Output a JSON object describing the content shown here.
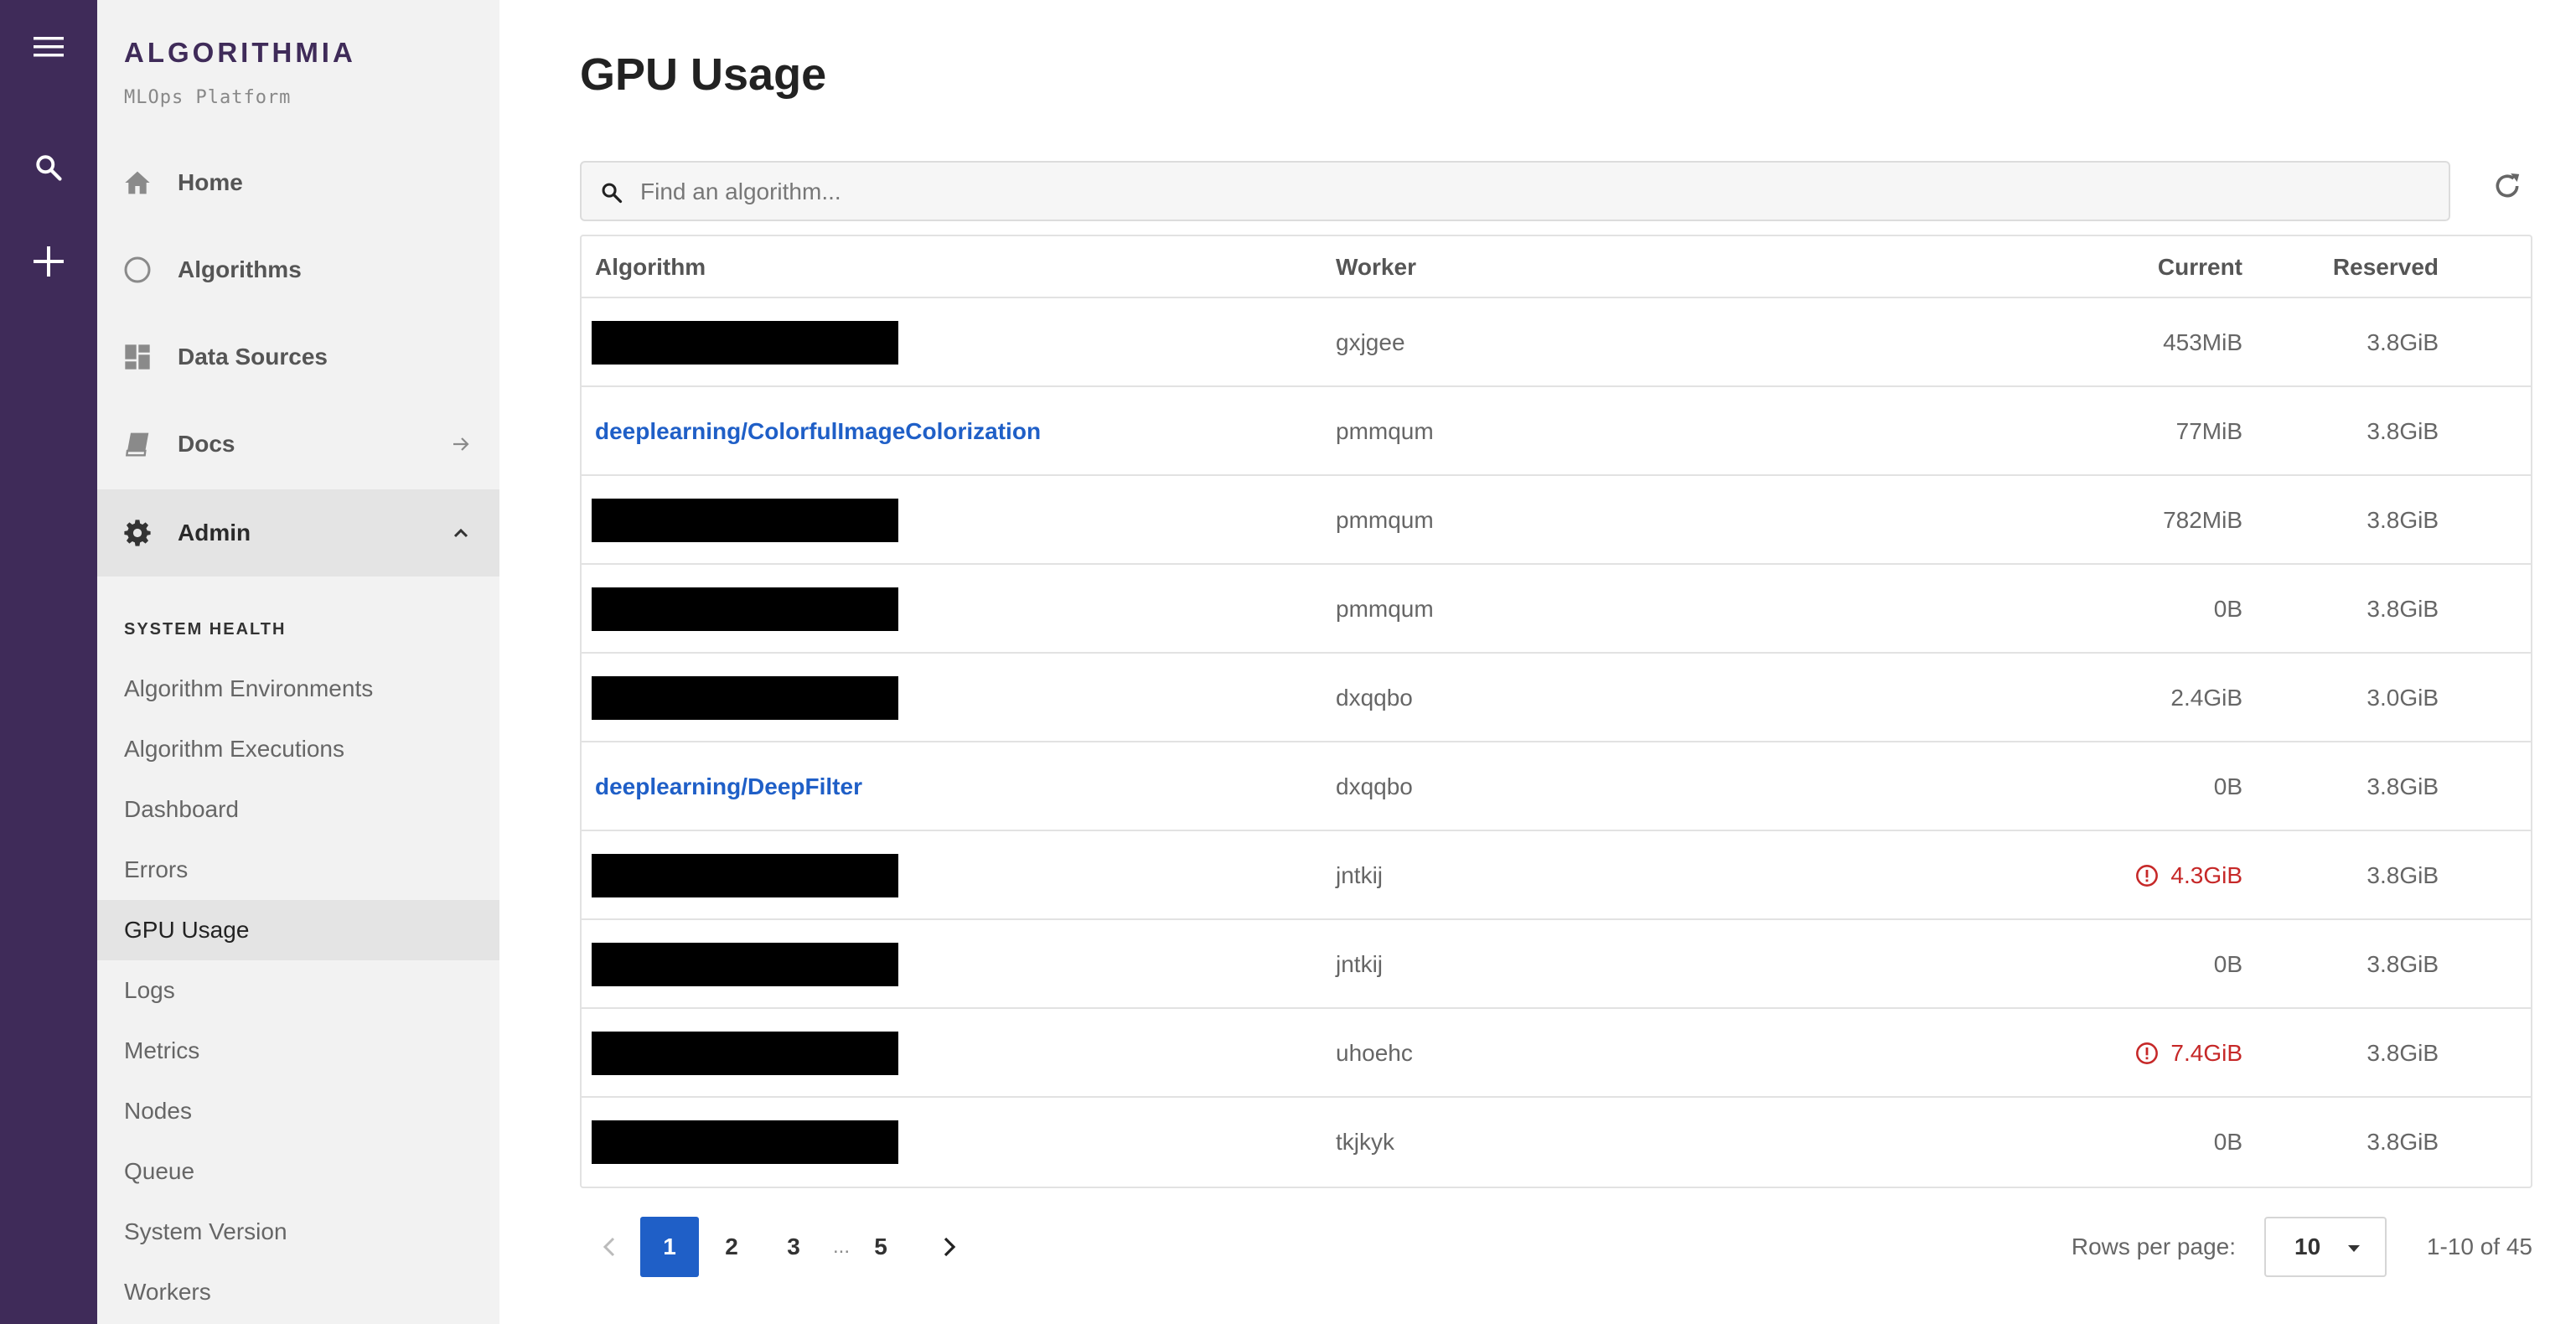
{
  "rail": {
    "icons": [
      "menu-icon",
      "search-icon",
      "plus-icon"
    ]
  },
  "sidebar": {
    "brand": "ALGORITHMIA",
    "tagline": "MLOps Platform",
    "nav": [
      {
        "label": "Home",
        "icon": "home-icon"
      },
      {
        "label": "Algorithms",
        "icon": "circle-icon"
      },
      {
        "label": "Data Sources",
        "icon": "dashboard-icon"
      },
      {
        "label": "Docs",
        "icon": "book-icon"
      },
      {
        "label": "Admin",
        "icon": "gear-icon"
      }
    ],
    "section_heading": "SYSTEM HEALTH",
    "sub_items": [
      {
        "label": "Algorithm Environments"
      },
      {
        "label": "Algorithm Executions"
      },
      {
        "label": "Dashboard"
      },
      {
        "label": "Errors"
      },
      {
        "label": "GPU Usage"
      },
      {
        "label": "Logs"
      },
      {
        "label": "Metrics"
      },
      {
        "label": "Nodes"
      },
      {
        "label": "Queue"
      },
      {
        "label": "System Version"
      },
      {
        "label": "Workers"
      }
    ],
    "active_sub_item": "GPU Usage"
  },
  "main": {
    "title": "GPU Usage",
    "search": {
      "placeholder": "Find an algorithm..."
    },
    "table": {
      "headers": {
        "algorithm": "Algorithm",
        "worker": "Worker",
        "current": "Current",
        "reserved": "Reserved"
      },
      "rows": [
        {
          "algorithm": "",
          "redacted": true,
          "worker": "gxjgee",
          "current": "453MiB",
          "over": false,
          "reserved": "3.8GiB"
        },
        {
          "algorithm": "deeplearning/ColorfulImageColorization",
          "redacted": false,
          "worker": "pmmqum",
          "current": "77MiB",
          "over": false,
          "reserved": "3.8GiB"
        },
        {
          "algorithm": "",
          "redacted": true,
          "worker": "pmmqum",
          "current": "782MiB",
          "over": false,
          "reserved": "3.8GiB"
        },
        {
          "algorithm": "",
          "redacted": true,
          "worker": "pmmqum",
          "current": "0B",
          "over": false,
          "reserved": "3.8GiB"
        },
        {
          "algorithm": "",
          "redacted": true,
          "worker": "dxqqbo",
          "current": "2.4GiB",
          "over": false,
          "reserved": "3.0GiB"
        },
        {
          "algorithm": "deeplearning/DeepFilter",
          "redacted": false,
          "worker": "dxqqbo",
          "current": "0B",
          "over": false,
          "reserved": "3.8GiB"
        },
        {
          "algorithm": "",
          "redacted": true,
          "worker": "jntkij",
          "current": "4.3GiB",
          "over": true,
          "reserved": "3.8GiB"
        },
        {
          "algorithm": "",
          "redacted": true,
          "worker": "jntkij",
          "current": "0B",
          "over": false,
          "reserved": "3.8GiB"
        },
        {
          "algorithm": "",
          "redacted": true,
          "worker": "uhoehc",
          "current": "7.4GiB",
          "over": true,
          "reserved": "3.8GiB"
        },
        {
          "algorithm": "",
          "redacted": true,
          "worker": "tkjkyk",
          "current": "0B",
          "over": false,
          "reserved": "3.8GiB"
        }
      ]
    },
    "pagination": {
      "pages": [
        "1",
        "2",
        "3",
        "5"
      ],
      "ellipsis": "...",
      "active_page": "1",
      "rows_per_page_label": "Rows per page:",
      "rows_per_page_value": "10",
      "range_text": "1-10 of 45"
    }
  },
  "colors": {
    "rail": "#3f2b59",
    "brand": "#3f2b59",
    "link": "#1f5fc7",
    "warning": "#c62828",
    "active_page": "#1f5fc7"
  }
}
